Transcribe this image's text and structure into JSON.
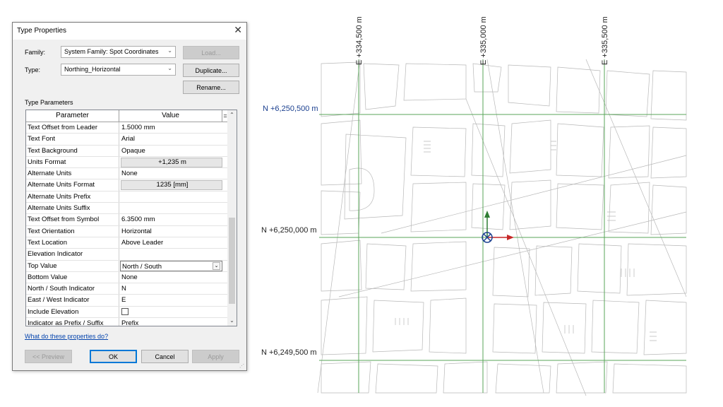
{
  "dialog": {
    "title": "Type Properties",
    "family_label": "Family:",
    "family_value": "System Family: Spot Coordinates",
    "type_label": "Type:",
    "type_value": "Northing_Horizontal",
    "load_button": "Load...",
    "duplicate_button": "Duplicate...",
    "rename_button": "Rename...",
    "section_title": "Type Parameters",
    "col_parameter": "Parameter",
    "col_value": "Value",
    "col_extra": "=",
    "params": [
      {
        "name": "Text Offset from Leader",
        "value": "1.5000 mm"
      },
      {
        "name": "Text Font",
        "value": "Arial"
      },
      {
        "name": "Text Background",
        "value": "Opaque"
      },
      {
        "name": "Units Format",
        "value": "+1,235 m"
      },
      {
        "name": "Alternate Units",
        "value": "None"
      },
      {
        "name": "Alternate Units Format",
        "value": "1235 [mm]"
      },
      {
        "name": "Alternate Units Prefix",
        "value": ""
      },
      {
        "name": "Alternate Units Suffix",
        "value": ""
      },
      {
        "name": "Text Offset from Symbol",
        "value": "6.3500 mm"
      },
      {
        "name": "Text Orientation",
        "value": "Horizontal"
      },
      {
        "name": "Text Location",
        "value": "Above Leader"
      },
      {
        "name": "Elevation Indicator",
        "value": ""
      },
      {
        "name": "Top Value",
        "value": "North / South"
      },
      {
        "name": "Bottom Value",
        "value": "None"
      },
      {
        "name": "North / South Indicator",
        "value": "N"
      },
      {
        "name": "East / West Indicator",
        "value": "E"
      },
      {
        "name": "Include Elevation",
        "value": ""
      },
      {
        "name": "Indicator as Prefix / Suffix",
        "value": "Prefix"
      }
    ],
    "help_link": "What do these properties do?",
    "preview_button": "<< Preview",
    "ok_button": "OK",
    "cancel_button": "Cancel",
    "apply_button": "Apply"
  },
  "map": {
    "eastings": [
      "E +334,500 m",
      "E +335,000 m",
      "E +335,500 m"
    ],
    "northings": [
      "N +6,250,500 m",
      "N +6,250,000 m",
      "N +6,249,500 m"
    ],
    "grid_color": "#5aa55a",
    "highlight_color": "#1a3f8f"
  }
}
